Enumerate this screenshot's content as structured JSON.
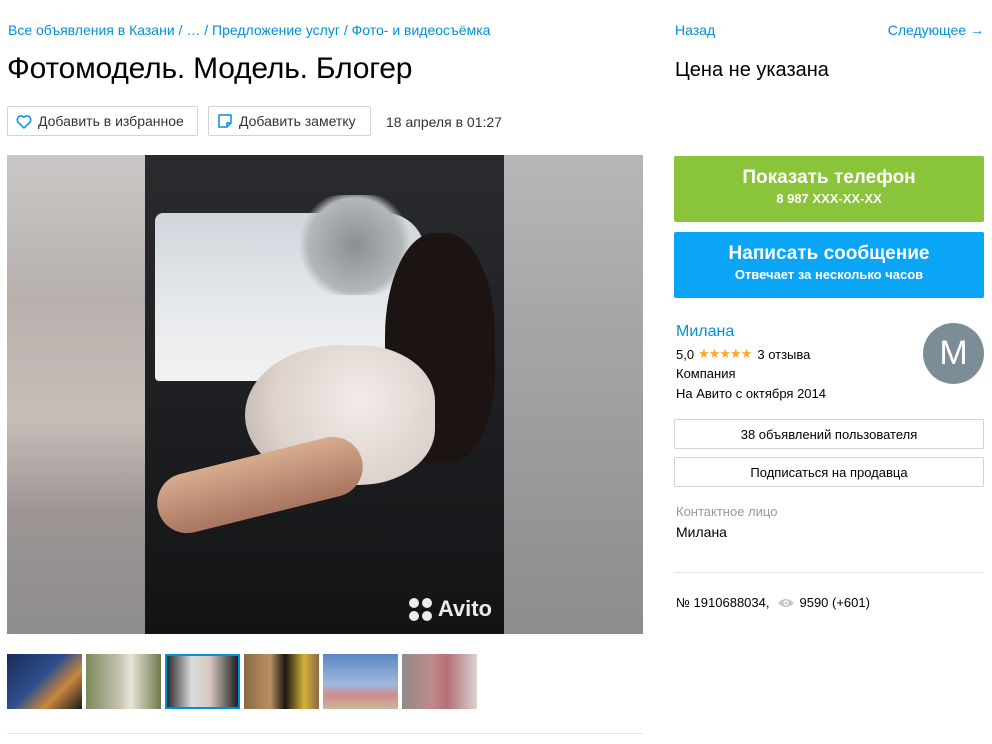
{
  "breadcrumb": {
    "all": "Все объявления в Казани",
    "sep1": " / … / ",
    "services": "Предложение услуг",
    "sep2": " / ",
    "photo": "Фото- и видеосъёмка"
  },
  "title": "Фотомодель. Модель. Блогер",
  "actions": {
    "favorite": "Добавить в избранное",
    "note": "Добавить заметку",
    "date": "18 апреля в 01:27"
  },
  "gallery": {
    "watermark": "Avito",
    "thumb_count": 6,
    "active_thumb": 3
  },
  "nav": {
    "back": "Назад",
    "next": "Следующее →"
  },
  "price": "Цена не указана",
  "phone": {
    "label": "Показать телефон",
    "number": "8 987 XXX-XX-XX",
    "color": "#8ac43a"
  },
  "message": {
    "label": "Написать сообщение",
    "sub": "Отвечает за несколько часов",
    "color": "#0ba5f5"
  },
  "seller": {
    "name": "Милана",
    "rating": "5,0",
    "stars": "★★★★★",
    "reviews": "3 отзыва",
    "type": "Компания",
    "since": "На Авито с октября 2014",
    "avatar_letter": "M",
    "listings_btn": "38 объявлений пользователя",
    "subscribe_btn": "Подписаться на продавца"
  },
  "contact": {
    "label": "Контактное лицо",
    "name": "Милана"
  },
  "stats": {
    "number": "№ 1910688034,",
    "views": "9590 (+601)"
  },
  "colors": {
    "link": "#0091d9",
    "star": "#f9a825"
  }
}
